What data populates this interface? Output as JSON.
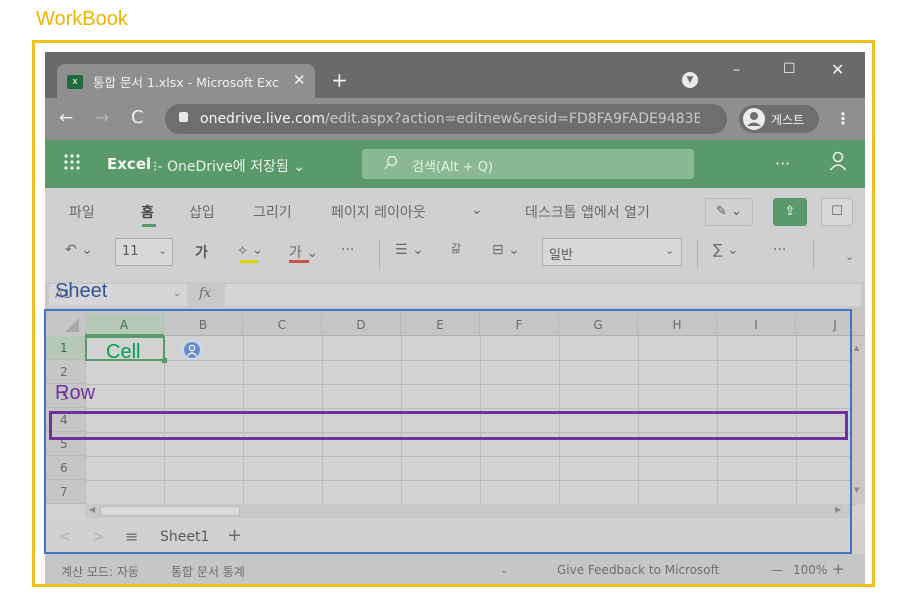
{
  "annotations": {
    "workbook": "WorkBook",
    "sheet": "Sheet",
    "row": "Row",
    "cell": "Cell",
    "colors": {
      "workbook": "#f0c020",
      "sheet": "#4472c4",
      "row": "#7030a0",
      "cell": "#00a050"
    }
  },
  "browser": {
    "tab_title": "통합 문서 1.xlsx - Microsoft Exc",
    "tab_close": "✕",
    "new_tab": "+",
    "window": {
      "minimize": "–",
      "maximize": "☐",
      "close": "✕"
    },
    "nav": {
      "back": "←",
      "forward": "→",
      "reload": "C"
    },
    "url_host": "onedrive.live.com",
    "url_path": "/edit.aspx?action=editnew&resid=FD8FA9FADE9483B...",
    "profile_label": "게스트",
    "menu": "⋮"
  },
  "app": {
    "waffle": "⠿",
    "name": "Excel",
    "doc_status": "⁝- OneDrive에 저장됨 ⌄",
    "search_icon": "⚲",
    "search_placeholder": "검색(Alt + Q)",
    "more": "···",
    "account_icon": "person-icon",
    "brand_color": "#5a9a6a"
  },
  "ribbon": {
    "tabs": [
      {
        "label": "파일"
      },
      {
        "label": "홈"
      },
      {
        "label": "삽입"
      },
      {
        "label": "그리기"
      },
      {
        "label": "페이지 레이아웃"
      },
      {
        "label": "⌄"
      },
      {
        "label": "데스크톱 앱에서 열기"
      }
    ],
    "active_tab": "홈",
    "edit_mode": "✎ ⌄",
    "share": "⇪",
    "comments": "☐",
    "toolbar": {
      "undo": "↶ ⌄",
      "font_size": "11",
      "font_size_chevron": "⌄",
      "bold": "가",
      "fill": "⟡ ⌄",
      "font_color": "가 ⌄",
      "more1": "···",
      "align": "☰ ⌄",
      "wrap": "갊",
      "merge": "⊟ ⌄",
      "number_format": "일반",
      "number_format_chevron": "⌄",
      "sum": "∑ ⌄",
      "more2": "···",
      "expand": "⌄"
    }
  },
  "formula": {
    "name_box": "A1",
    "name_box_chevron": "⌄",
    "fx": "fx",
    "value": ""
  },
  "grid": {
    "columns": [
      "A",
      "B",
      "C",
      "D",
      "E",
      "F",
      "G",
      "H",
      "I",
      "J"
    ],
    "rows": [
      "1",
      "2",
      "3",
      "4",
      "5",
      "6",
      "7"
    ],
    "selected_cell": "A1",
    "presence_icon": "person-icon"
  },
  "sheets": {
    "prev": "<",
    "next": ">",
    "list": "≡",
    "tabs": [
      "Sheet1"
    ],
    "add": "+"
  },
  "status": {
    "calc_mode": "계산 모드: 자동",
    "workbook_stats": "통합 문서 통계",
    "chevron": "⌄",
    "feedback": "Give Feedback to Microsoft",
    "zoom_out": "—",
    "zoom": "100%",
    "zoom_in": "+"
  }
}
